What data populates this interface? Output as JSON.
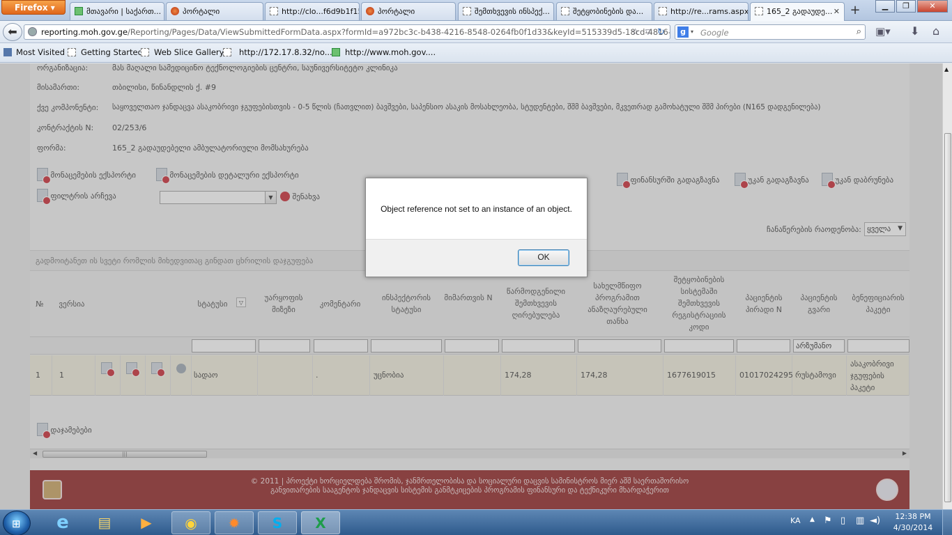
{
  "browser": {
    "app_button": "Firefox",
    "tabs": [
      {
        "label": "მთავარი   | საქართ...",
        "icon": "green-flag-icon",
        "active": false
      },
      {
        "label": "პორტალი",
        "icon": "red-emblem-icon",
        "active": false
      },
      {
        "label": "http://clo...f6d9b1f15",
        "icon": "blank-page-icon",
        "active": false
      },
      {
        "label": "პორტალი",
        "icon": "red-emblem-icon",
        "active": false
      },
      {
        "label": "შემთხვევის ინსპექ...",
        "icon": "blank-page-icon",
        "active": false
      },
      {
        "label": "შეტყობინების და...",
        "icon": "blank-page-icon",
        "active": false
      },
      {
        "label": "http://re...rams.aspx",
        "icon": "blank-page-icon",
        "active": false
      },
      {
        "label": "165_2 გადაუდე...",
        "icon": "blank-page-icon",
        "active": true
      }
    ],
    "url_host": "reporting.moh.gov.ge",
    "url_path": "/Reporting/Pages/Data/ViewSubmittedFormData.aspx?formId=a972bc3c-b438-4216-8548-0264fb0f1d33&keyId=515339d5-18cd-4816-8cb",
    "search_placeholder": "Google",
    "bookmarks": [
      {
        "label": "Most Visited",
        "icon": "star-icon"
      },
      {
        "label": "Getting Started",
        "icon": "blank-page-icon"
      },
      {
        "label": "Web Slice Gallery",
        "icon": "blank-page-icon"
      },
      {
        "label": "http://172.17.8.32/no...",
        "icon": "blank-page-icon"
      },
      {
        "label": "http://www.moh.gov....",
        "icon": "green-flag-icon"
      }
    ]
  },
  "form_info": {
    "org_label": "ორგანიზაცია:",
    "org_value": "მას მაღალი სამედიცინო ტექნოლოგიების ცენტრი, საუნივერსიტეტო კლინიკა",
    "address_label": "მისამართი:",
    "address_value": "თბილისი, წინანდლის ქ. #9",
    "subcomponent_label": "ქვე კომპონენტი:",
    "subcomponent_value": "საყოველთაო ჯანდაცვა ასაკობრივი ჯგუფებისთვის - 0-5 წლის (ჩათვლით) ბავშვები, საპენსიო ასაკის მოსახლეობა, სტუდენტები, შშმ ბავშვები, მკვეთრად გამოხატული შშმ პირები (N165 დადგენილება)",
    "contract_label": "კონტრაქტის N:",
    "contract_value": "02/253/6",
    "form_label": "ფორმა:",
    "form_value": "165_2 გადაუდებელი ამბულატორიული მომსახურება"
  },
  "toolbar": {
    "export_data": "მონაცემების ექსპორტი",
    "export_detailed": "მონაცემების დეტალური ექსპორტი",
    "to_financial": "ფინანსურში გადაგზავნა",
    "send_back": "უკან გადაგზავნა",
    "return_back": "უკან დაბრუნება",
    "filter_choice": "ფილტრის არჩევა",
    "save": "შენახვა",
    "records_count_label": "ჩანაწერების რაოდენობა:",
    "records_count_value": "ყველა",
    "grouping_hint": "გადმოიტანეთ ის სვეტი რომლის მიხედვითაც გინდათ ცხრილის დაჯგუფება"
  },
  "grid": {
    "columns": {
      "num": "№",
      "version": "ვერსია",
      "status": "სტატუსი",
      "rejection": "უარყოფის მიზეზი",
      "comment": "კომენტარი",
      "inspector_status": "ინსპექტორის სტატუსი",
      "addressee": "მიმართვის N",
      "submitted_cost": "წარმოდგენილი შემთხვევის ღირებულება",
      "state_funded": "სახელმწიფო პროგრამით ანაზღაურებული თანხა",
      "reg_code": "შეტყობინების სისტემაში შემთხვევის რეგისტრაციის კოდი",
      "personal_no": "პაციენტის პირადი N",
      "surname": "პაციენტის გვარი",
      "beneficiary_package": "ბენეფიციარის პაკეტი"
    },
    "filter_surname": "არზუმანო",
    "row": {
      "num": "1",
      "version": "1",
      "status": "სადაო",
      "comment": ".",
      "inspector_status": "უცნობია",
      "submitted_cost": "174,28",
      "state_funded": "174,28",
      "reg_code": "1677619015",
      "personal_no": "01017024295",
      "surname": "რუსტამოვი",
      "beneficiary_package": "ასაკობრივი ჯგუფების პაკეტი"
    }
  },
  "totals_label": "დაჯამებები",
  "footer": {
    "line1": "© 2011 | პროექტი ხორციელდება შრომის, ჯანმრთელობისა და სოციალური დაცვის სამინისტროს მიერ აშშ საერთაშორისო",
    "line2": "განვითარების სააგენტოს ჯანდაცვის სისტემის განმტკიცების პროგრამის ფინანსური და ტექნიკური მხარდაჭერით"
  },
  "dialog": {
    "message": "Object reference not set to an instance of an object.",
    "ok_label": "OK"
  },
  "taskbar": {
    "apps": [
      {
        "name": "internet-explorer-icon",
        "glyph": "e"
      },
      {
        "name": "file-explorer-icon",
        "glyph": "▤"
      },
      {
        "name": "media-player-icon",
        "glyph": "▶"
      },
      {
        "name": "chrome-icon",
        "glyph": "◉"
      },
      {
        "name": "firefox-icon",
        "glyph": "✹"
      },
      {
        "name": "skype-icon",
        "glyph": "S"
      },
      {
        "name": "excel-icon",
        "glyph": "X"
      }
    ],
    "lang": "KA",
    "time": "12:38 PM",
    "date": "4/30/2014"
  },
  "colors": {
    "footer_bg": "#8d1a1a",
    "row_highlight": "#f1eedb",
    "firefox_orange": "#e0661b",
    "taskbar_blue": "#2e5a8c"
  }
}
